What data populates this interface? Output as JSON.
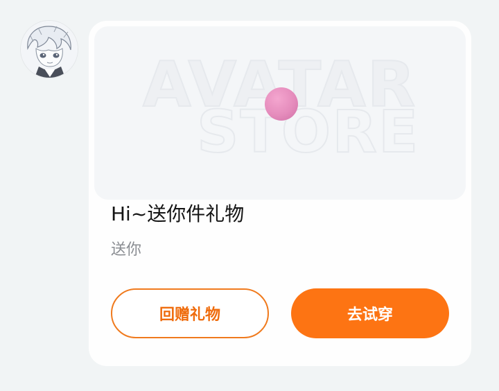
{
  "avatar": {
    "icon": "anime-character-avatar"
  },
  "card": {
    "banner": {
      "watermark_line1": "AVATAR",
      "watermark_line2": "STORE",
      "item_icon": "pink-ball-icon"
    },
    "title": "Hi~送你件礼物",
    "subtitle": "送你",
    "buttons": {
      "return_gift": "回赠礼物",
      "try_on": "去试穿"
    }
  },
  "colors": {
    "accent": "#fd7413",
    "background": "#f1f4f5",
    "card": "#fefefe"
  }
}
